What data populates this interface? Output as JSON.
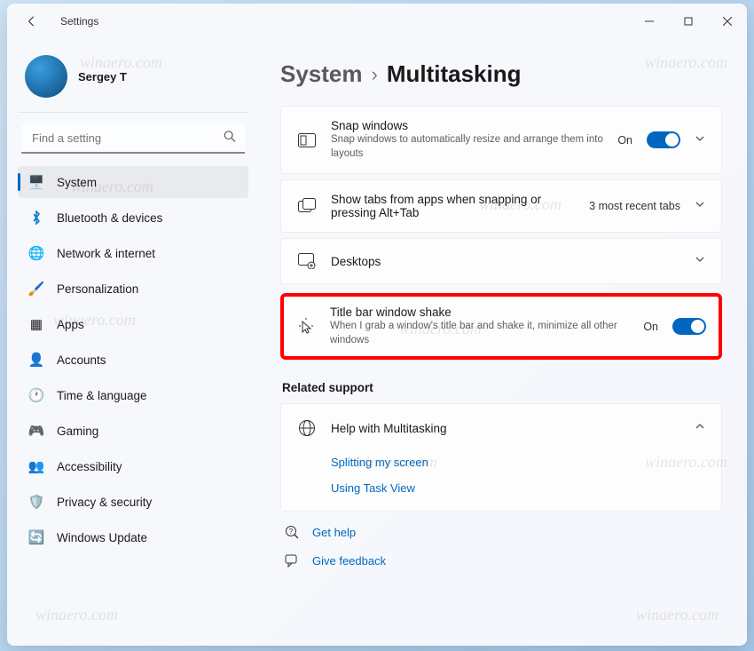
{
  "app": {
    "name": "Settings"
  },
  "user": {
    "name": "Sergey T"
  },
  "search": {
    "placeholder": "Find a setting"
  },
  "nav": [
    {
      "label": "System",
      "icon": "💻",
      "selected": true
    },
    {
      "label": "Bluetooth & devices",
      "icon": "bt"
    },
    {
      "label": "Network & internet",
      "icon": "🔷"
    },
    {
      "label": "Personalization",
      "icon": "🖌️"
    },
    {
      "label": "Apps",
      "icon": "🟦"
    },
    {
      "label": "Accounts",
      "icon": "👤"
    },
    {
      "label": "Time & language",
      "icon": "🕒"
    },
    {
      "label": "Gaming",
      "icon": "🎮"
    },
    {
      "label": "Accessibility",
      "icon": "♿"
    },
    {
      "label": "Privacy & security",
      "icon": "🛡️"
    },
    {
      "label": "Windows Update",
      "icon": "🔄"
    }
  ],
  "breadcrumb": {
    "parent": "System",
    "current": "Multitasking"
  },
  "cards": {
    "snap": {
      "title": "Snap windows",
      "desc": "Snap windows to automatically resize and arrange them into layouts",
      "state": "On"
    },
    "tabs": {
      "title": "Show tabs from apps when snapping or pressing Alt+Tab",
      "value": "3 most recent tabs"
    },
    "desktops": {
      "title": "Desktops"
    },
    "shake": {
      "title": "Title bar window shake",
      "desc": "When I grab a window's title bar and shake it, minimize all other windows",
      "state": "On"
    }
  },
  "related": {
    "heading": "Related support",
    "help": {
      "title": "Help with Multitasking",
      "links": [
        "Splitting my screen",
        "Using Task View"
      ]
    }
  },
  "bottom": {
    "getHelp": "Get help",
    "feedback": "Give feedback"
  },
  "watermark": "winaero.com"
}
